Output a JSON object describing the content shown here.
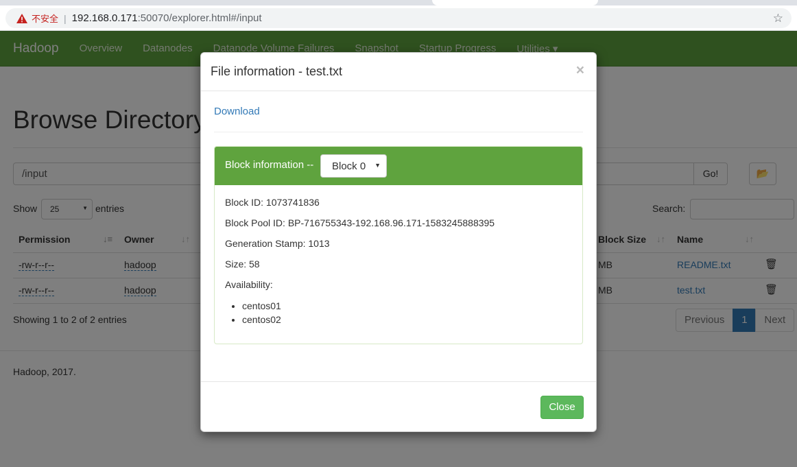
{
  "browser": {
    "insecure_label": "不安全",
    "url_host": "192.168.0.171",
    "url_rest": ":50070/explorer.html#/input"
  },
  "navbar": {
    "brand": "Hadoop",
    "items": [
      "Overview",
      "Datanodes",
      "Datanode Volume Failures",
      "Snapshot",
      "Startup Progress",
      "Utilities ▾"
    ]
  },
  "page": {
    "title": "Browse Directory",
    "path_value": "/input",
    "go_label": "Go!",
    "show_label": "Show",
    "entries_value": "25",
    "entries_label": "entries",
    "search_label": "Search:",
    "columns": {
      "permission": "Permission",
      "owner": "Owner",
      "block_size": "Block Size",
      "name": "Name"
    },
    "rows": [
      {
        "permission": "-rw-r--r--",
        "owner": "hadoop",
        "block_size": "MB",
        "name": "README.txt"
      },
      {
        "permission": "-rw-r--r--",
        "owner": "hadoop",
        "block_size": "MB",
        "name": "test.txt"
      }
    ],
    "showing": "Showing 1 to 2 of 2 entries",
    "pager": {
      "previous": "Previous",
      "current": "1",
      "next": "Next"
    },
    "footer": "Hadoop, 2017."
  },
  "modal": {
    "title": "File information - test.txt",
    "close_x": "×",
    "download": "Download",
    "block_heading": "Block information --",
    "block_select": "Block 0",
    "block_id": "Block ID: 1073741836",
    "block_pool_id": "Block Pool ID: BP-716755343-192.168.96.171-1583245888395",
    "generation_stamp": "Generation Stamp: 1013",
    "size": "Size: 58",
    "availability_label": "Availability:",
    "availability": [
      "centos01",
      "centos02"
    ],
    "close_button": "Close"
  },
  "colors": {
    "navbar_green": "#5fa33e",
    "link_blue": "#337ab7",
    "close_green": "#5cb85c"
  }
}
